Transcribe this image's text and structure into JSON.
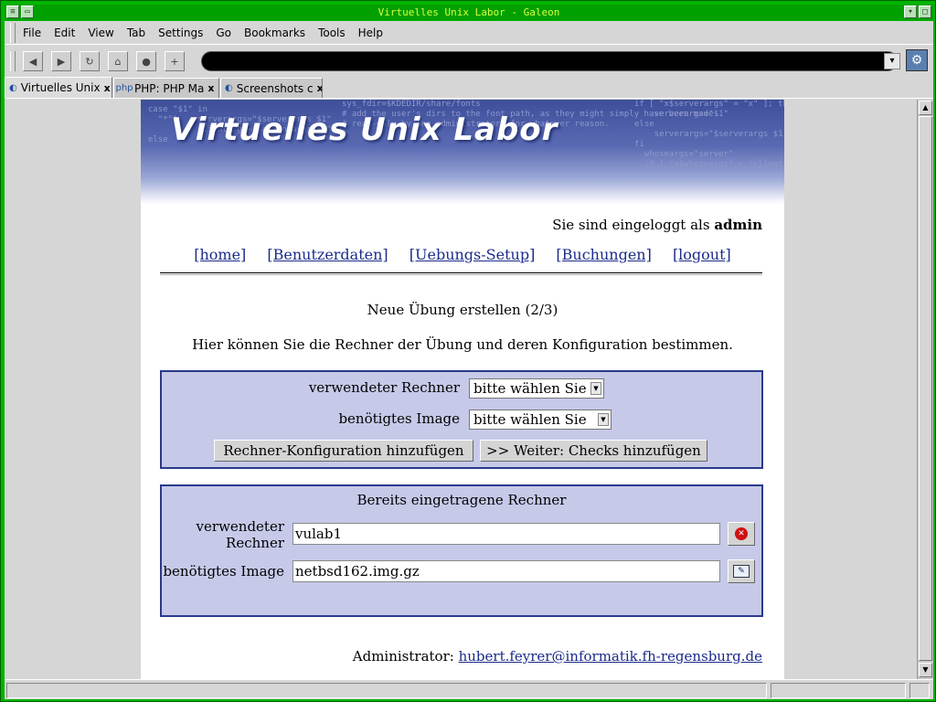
{
  "window": {
    "title": "Virtuelles Unix Labor - Galeon"
  },
  "menu": [
    {
      "label": "File"
    },
    {
      "label": "Edit"
    },
    {
      "label": "View"
    },
    {
      "label": "Tab"
    },
    {
      "label": "Settings"
    },
    {
      "label": "Go"
    },
    {
      "label": "Bookmarks"
    },
    {
      "label": "Tools"
    },
    {
      "label": "Help"
    }
  ],
  "toolbar": {
    "url": ""
  },
  "tabs": [
    {
      "label": "Virtuelles Unix",
      "icon": "globe-icon"
    },
    {
      "label": "PHP: PHP Ma",
      "icon": "php-icon"
    },
    {
      "label": "Screenshots c",
      "icon": "globe-icon"
    }
  ],
  "page": {
    "banner_title": "Virtuelles Unix Labor",
    "login_text": "Sie sind eingeloggt als",
    "login_user": "admin",
    "nav": [
      {
        "label": "[home]"
      },
      {
        "label": "[Benutzerdaten]"
      },
      {
        "label": "[Uebungs-Setup]"
      },
      {
        "label": "[Buchungen]"
      },
      {
        "label": "[logout]"
      }
    ],
    "heading": "Neue Übung erstellen (2/3)",
    "intro": "Hier können Sie die Rechner der Übung und deren Konfiguration bestimmen.",
    "form": {
      "rechner_label": "verwendeter Rechner",
      "rechner_value": "bitte wählen Sie",
      "image_label": "benötigtes Image",
      "image_value": "bitte wählen Sie",
      "add_button": "Rechner-Konfiguration hinzufügen",
      "next_button": ">> Weiter: Checks hinzufügen"
    },
    "existing": {
      "title": "Bereits eingetragene Rechner",
      "rechner_label_1": "verwendeter",
      "rechner_label_2": "Rechner",
      "rechner_value": "vulab1",
      "image_label": "benötigtes Image",
      "image_value": "netbsd162.img.gz"
    },
    "footer_label": "Administrator:",
    "footer_email": "hubert.feyrer@informatik.fh-regensburg.de"
  }
}
